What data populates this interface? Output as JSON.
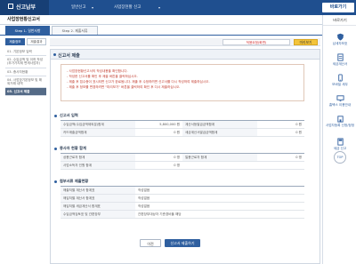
{
  "topbar": {
    "logo": "신고납부",
    "nav": [
      "일반신고",
      "사업장현황 신고"
    ]
  },
  "quick_menu_label": "바로가기",
  "page": {
    "title": "사업장현황신고서"
  },
  "tabs": [
    "Step 1. 일반사항",
    "Step 2. 제출서류"
  ],
  "left_tabs": [
    "제출정보",
    "제출결과"
  ],
  "left_nav": [
    "01. 기본정보 입력",
    "02. 수입금액 및 이하 작성(부가가치세 면세사업자)",
    "03. 종사자현황",
    "04. 사업장기본정보 및 해외거래 내역",
    "05. 신고서 제출"
  ],
  "info_bar": {
    "badge_label": "적용요청(화면)",
    "button_label": "미리보기"
  },
  "panel": {
    "title": "신고서 제출",
    "notice": [
      "- 사업장현황신고서의 작성내용을 확인합니다.",
      "- 작성한 신고서를 확인 후 제출 버튼을 클릭하십시오.",
      "- 제출 후 접수증이 표시되면 신고가 완료됩니다. 제출 후 수정하려면 신고서를 다시 작성하여 제출하십시오.",
      "- 제출 후 정보를 변경하려면 \"미리보기\" 버튼을 클릭하여 확인 후 다시 제출하십시오."
    ]
  },
  "section1": {
    "title": "신고서 입력",
    "rows": [
      [
        "수입금액(수입금액제외분)합계",
        "5,800,000 원",
        "계산서등발급금액합계",
        "0 원"
      ],
      [
        "카드매출금액합계",
        "0 원",
        "세금계산서발급금액합계",
        "0 원"
      ]
    ]
  },
  "section2": {
    "title": "종사자 현황 합계",
    "rows": [
      [
        "상용근로자 합계",
        "0 명",
        "일용근로자 합계",
        "0 명"
      ],
      [
        "사업소득자 인원 합계",
        "0 명",
        "",
        ""
      ]
    ]
  },
  "section3": {
    "title": "첨부서류 제출현황",
    "rows": [
      [
        "매출처별 계산서 합계표",
        "작성없음"
      ],
      [
        "매입처별 계산서 합계표",
        "작성없음"
      ],
      [
        "매입처별 세금계산서 합계표",
        "작성없음"
      ],
      [
        "수입금액검토표 및 간편장부",
        "간편장부대상자 기준경비율 해당"
      ]
    ]
  },
  "buttons": {
    "prev": "이전",
    "submit": "신고서 제출하기"
  },
  "right_sidebar": [
    "납세자보호",
    "세금계산서",
    "모바일 세무",
    "홈택스 이용안내",
    "사업자등록 신청/정정",
    "세금 신고",
    "TOP"
  ]
}
